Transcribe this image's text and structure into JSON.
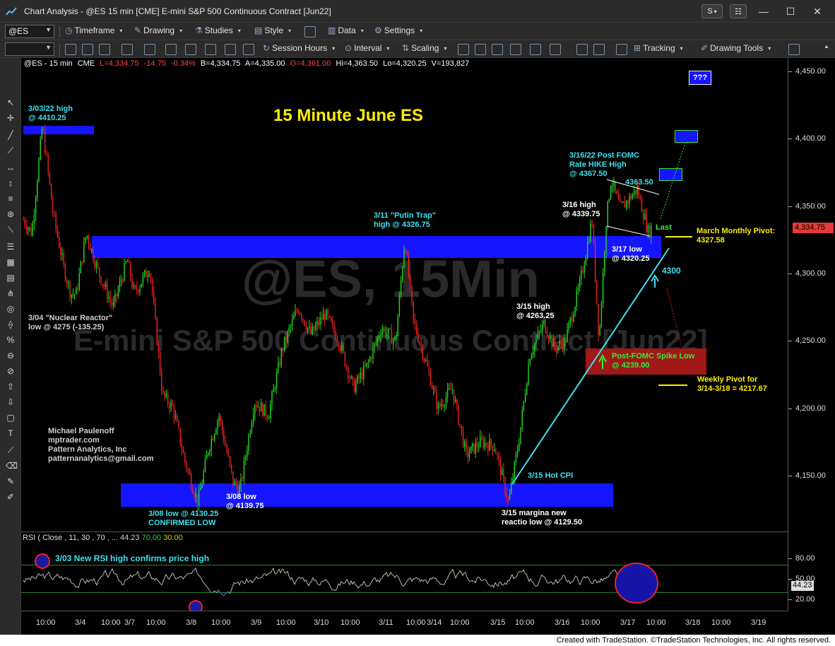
{
  "window": {
    "title": "Chart Analysis - @ES 15 min [CME] E-mini S&P 500 Continuous Contract [Jun22]",
    "btn_s": "S",
    "controls": [
      "—",
      "☐",
      "✕"
    ]
  },
  "toolbar1": {
    "symbol": "@ES",
    "items": [
      "Timeframe",
      "Drawing",
      "Studies",
      "Style",
      "Data",
      "Settings"
    ]
  },
  "toolbar2": {
    "items": [
      "Session Hours",
      "Interval",
      "Scaling",
      "Tracking",
      "Drawing Tools"
    ]
  },
  "chart": {
    "infoline": {
      "symbol": "@ES - 15 min",
      "exchange": "CME",
      "last": "L=4,334.75",
      "chg": "-14.75",
      "pct": "-0.34%",
      "bid": "B=4,334.75",
      "ask": "A=4,335.00",
      "open": "O=4,361.00",
      "high": "Hi=4,363.50",
      "low": "Lo=4,320.25",
      "vol": "V=193,827"
    },
    "title": "15 Minute June ES",
    "watermark_symbol": "@ES, 15Min",
    "watermark_name": "E-mini S&P 500 Continuous Contract [Jun22]",
    "qbox": "???",
    "annotations": {
      "a1": "3/03/22 high\n@ 4410.25",
      "a2": "3/04 \"Nuclear Reactor\"\nlow @ 4275 (-135.25)",
      "a3": "Michael Paulenoff\nmptrader.com\nPattern Analytics, Inc\npatternanalytics@gmail.com",
      "a4": "3/08 low @ 4130.25\nCONFIRMED LOW",
      "a5": "3/08 low\n@ 4139.75",
      "a6": "3/11 \"Putin Trap\"\nhigh @ 4326.75",
      "a7": "3/15 high\n@ 4263.25",
      "a8": "3/15 Hot CPI",
      "a9": "3/15 margina new\nreactio low @ 4129.50",
      "a10": "3/16 high\n@ 4339.75",
      "a11": "3/16/22 Post FOMC\nRate HIKE High\n@ 4367.50",
      "a12": "4363.50",
      "a13": "3/17 low\n@ 4320.25",
      "a14": "Last",
      "a15": "March Monthly Pivot:\n4327.58",
      "a16": "4300",
      "a17": "Post-FOMC Spike Low\n@ 4239.00",
      "a18": "Weekly Pivot for\n3/14-3/18 = 4217.67"
    }
  },
  "yaxis": {
    "labels": [
      "4,450.00",
      "4,400.00",
      "4,350.00",
      "4,300.00",
      "4,250.00",
      "4,200.00",
      "4,150.00"
    ],
    "last_price": "4,334.75"
  },
  "rsi": {
    "label": "RSI (",
    "params": "Close , 11, 30 , 70 , ...",
    "v1": "44.23",
    "v2": "70.00",
    "v3": "30.00",
    "note": "3/03 New RSI high confirms price high",
    "axis": [
      "80.00",
      "50.00",
      "20.00"
    ],
    "current": "44.23"
  },
  "xaxis": {
    "labels": [
      "10:00",
      "3/4",
      "10:00",
      "3/7",
      "10:00",
      "3/8",
      "10:00",
      "3/9",
      "10:00",
      "3/10",
      "10:00",
      "3/11",
      "10:00",
      "3/14",
      "10:00",
      "3/15",
      "10:00",
      "3/16",
      "10:00",
      "3/17",
      "10:00",
      "3/18",
      "10:00",
      "3/19"
    ]
  },
  "footer": "Created with TradeStation. ©TradeStation Technologies, Inc. All rights reserved.",
  "colors": {
    "band": "#1515ff",
    "accent": "#3fe0f0",
    "title": "#ffee00",
    "up": "#22dd22",
    "down": "#ee2222"
  }
}
